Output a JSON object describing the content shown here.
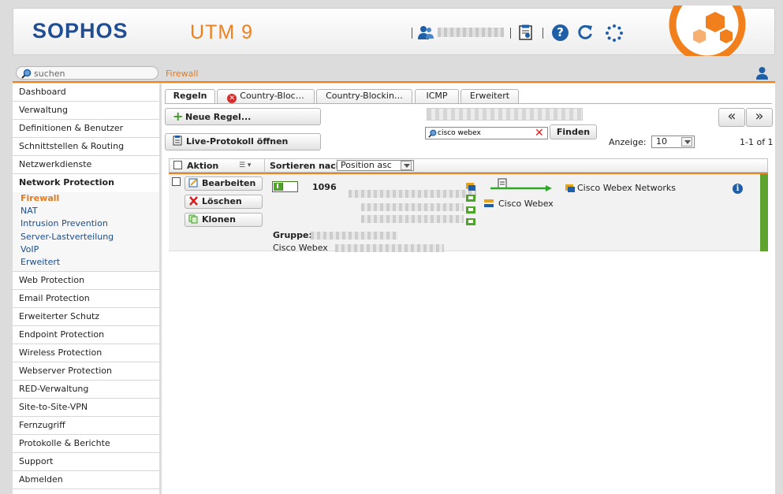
{
  "header": {
    "logo": "SOPHOS",
    "product": "UTM 9",
    "help_glyph": "?"
  },
  "search": {
    "placeholder": "suchen"
  },
  "breadcrumb": "Firewall",
  "sidebar": {
    "items_top": [
      {
        "name": "dashboard",
        "label": "Dashboard"
      },
      {
        "name": "verwaltung",
        "label": "Verwaltung"
      },
      {
        "name": "definitionen",
        "label": "Definitionen & Benutzer"
      },
      {
        "name": "schnittstellen",
        "label": "Schnittstellen & Routing"
      },
      {
        "name": "netzwerkdienste",
        "label": "Netzwerkdienste"
      }
    ],
    "open_item": "Network Protection",
    "subitems": [
      {
        "name": "firewall",
        "label": "Firewall",
        "active": true
      },
      {
        "name": "nat",
        "label": "NAT"
      },
      {
        "name": "intrusion-prevention",
        "label": "Intrusion Prevention"
      },
      {
        "name": "server-lastverteilung",
        "label": "Server-Lastverteilung"
      },
      {
        "name": "voip",
        "label": "VoIP"
      },
      {
        "name": "erweitert",
        "label": "Erweitert"
      }
    ],
    "items_bottom": [
      {
        "name": "web-protection",
        "label": "Web Protection"
      },
      {
        "name": "email-protection",
        "label": "Email Protection"
      },
      {
        "name": "erweiterter-schutz",
        "label": "Erweiterter Schutz"
      },
      {
        "name": "endpoint-protection",
        "label": "Endpoint Protection"
      },
      {
        "name": "wireless-protection",
        "label": "Wireless Protection"
      },
      {
        "name": "webserver-protection",
        "label": "Webserver Protection"
      },
      {
        "name": "red-verwaltung",
        "label": "RED-Verwaltung"
      },
      {
        "name": "site-to-site-vpn",
        "label": "Site-to-Site-VPN"
      },
      {
        "name": "fernzugriff",
        "label": "Fernzugriff"
      },
      {
        "name": "protokolle",
        "label": "Protokolle & Berichte"
      },
      {
        "name": "support",
        "label": "Support"
      },
      {
        "name": "abmelden",
        "label": "Abmelden"
      }
    ]
  },
  "tabs": {
    "regeln": "Regeln",
    "country_blocking": "Country-Bloc…",
    "country_blocking_exceptions": "Country-Blockin…",
    "icmp": "ICMP",
    "erweitert": "Erweitert"
  },
  "toolbar": {
    "new_rule": "Neue Regel...",
    "live_log": "Live-Protokoll öffnen",
    "filter_value": "cisco webex",
    "find": "Finden",
    "show_label": "Anzeige:",
    "page_size": "10",
    "page_count": "1-1 of 1",
    "prev_glyph": "«",
    "next_glyph": "»"
  },
  "table": {
    "action_header": "Aktion",
    "sort_label": "Sortieren nach:",
    "sort_value": "Position asc"
  },
  "rule": {
    "edit": "Bearbeiten",
    "delete": "Löschen",
    "clone": "Klonen",
    "number": "1096",
    "service": "Cisco Webex Networks",
    "destination": "Cisco Webex",
    "group_label": "Gruppe:",
    "comment_label": "Cisco Webex"
  },
  "colors": {
    "brand_blue": "#1f4e96",
    "accent_orange": "#f07f1c",
    "enabled_green": "#5fa32e"
  }
}
